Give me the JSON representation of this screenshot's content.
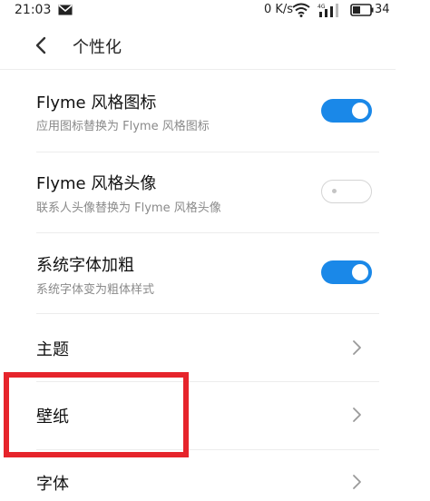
{
  "status_bar": {
    "time": "21:03",
    "network_speed": "0 K/s",
    "battery_level": "34",
    "icons": [
      "message-icon",
      "wifi-icon",
      "signal-icon",
      "battery-icon"
    ]
  },
  "header": {
    "title": "个性化",
    "back_icon": "back-arrow-icon"
  },
  "settings": {
    "flyme_icons": {
      "title": "Flyme 风格图标",
      "subtitle": "应用图标替换为 Flyme 风格图标",
      "enabled": true
    },
    "flyme_avatar": {
      "title": "Flyme 风格头像",
      "subtitle": "联系人头像替换为 Flyme 风格头像",
      "enabled": false
    },
    "bold_font": {
      "title": "系统字体加粗",
      "subtitle": "系统字体变为粗体样式",
      "enabled": true
    },
    "theme": {
      "title": "主题"
    },
    "wallpaper": {
      "title": "壁纸"
    },
    "font": {
      "title": "字体"
    }
  },
  "colors": {
    "toggle_on": "#1a88e8",
    "annotation": "#e6242b"
  }
}
